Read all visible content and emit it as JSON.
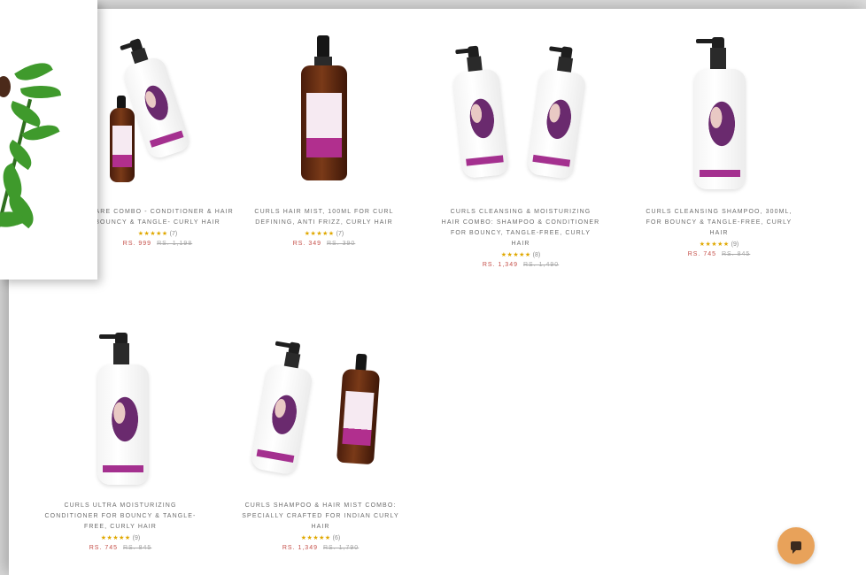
{
  "products": [
    {
      "name": "N CARE COMBO - CONDITIONER & HAIR BOUNCY & TANGLE- CURLY HAIR",
      "stars": "★★★★★",
      "count": "(7)",
      "price": "RS. 999",
      "mrp": "RS. 1,198"
    },
    {
      "name": "CURLS HAIR MIST, 100ML FOR CURL DEFINING, ANTI FRIZZ, CURLY HAIR",
      "stars": "★★★★★",
      "count": "(7)",
      "price": "RS. 349",
      "mrp": "RS. 390"
    },
    {
      "name": "CURLS CLEANSING & MOISTURIZING HAIR COMBO: SHAMPOO & CONDITIONER FOR BOUNCY, TANGLE-FREE, CURLY HAIR",
      "stars": "★★★★★",
      "count": "(8)",
      "price": "RS. 1,349",
      "mrp": "RS. 1,490"
    },
    {
      "name": "CURLS CLEANSING SHAMPOO, 300ML, FOR BOUNCY & TANGLE-FREE, CURLY HAIR",
      "stars": "★★★★★",
      "count": "(9)",
      "price": "RS. 745",
      "mrp": "RS. 845"
    },
    {
      "name": "CURLS ULTRA MOISTURIZING CONDITIONER FOR BOUNCY & TANGLE-FREE, CURLY HAIR",
      "stars": "★★★★★",
      "count": "(9)",
      "price": "RS. 745",
      "mrp": "RS. 845"
    },
    {
      "name": "CURLS SHAMPOO & HAIR MIST COMBO: SPECIALLY CRAFTED FOR INDIAN CURLY HAIR",
      "stars": "★★★★★",
      "count": "(6)",
      "price": "RS. 1,349",
      "mrp": "RS. 1,790"
    }
  ],
  "chat": {
    "icon": "chat-bubble-icon"
  },
  "colors": {
    "accent": "#a4308f",
    "sale": "#c5504a",
    "star": "#e0a800",
    "chat_button": "#e8a25a"
  }
}
